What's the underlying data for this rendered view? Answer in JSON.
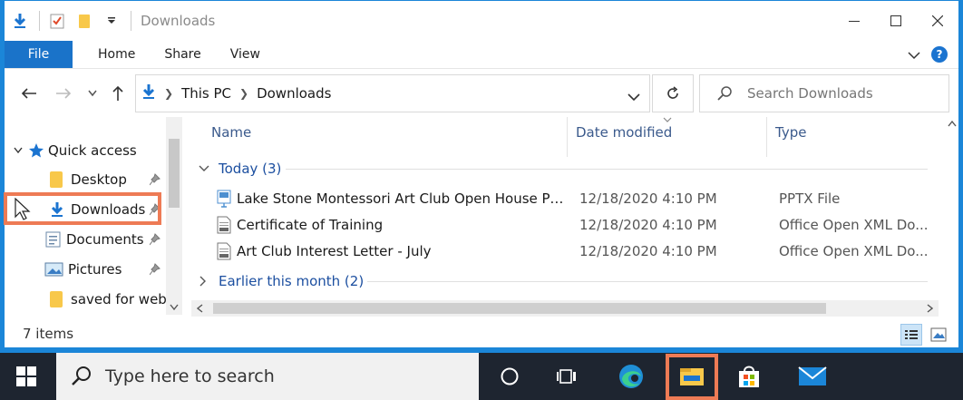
{
  "window": {
    "title": "Downloads",
    "ribbon_tabs": {
      "file": "File",
      "home": "Home",
      "share": "Share",
      "view": "View"
    },
    "help_label": "?"
  },
  "address": {
    "crumbs": [
      "This PC",
      "Downloads"
    ],
    "search_placeholder": "Search Downloads"
  },
  "nav": {
    "quick_access": "Quick access",
    "items": [
      {
        "label": "Desktop",
        "icon": "folder-icon",
        "pinned": true
      },
      {
        "label": "Downloads",
        "icon": "download-arrow-icon",
        "pinned": true,
        "selected": true
      },
      {
        "label": "Documents",
        "icon": "documents-icon",
        "pinned": true
      },
      {
        "label": "Pictures",
        "icon": "pictures-icon",
        "pinned": true
      },
      {
        "label": "saved for web_",
        "icon": "folder-icon",
        "pinned": false
      }
    ]
  },
  "columns": {
    "name": "Name",
    "date": "Date modified",
    "type": "Type"
  },
  "groups": {
    "today": "Today (3)",
    "earlier": "Earlier this month (2)"
  },
  "files": [
    {
      "name": "Lake Stone Montessori Art Club Open House Pr...",
      "date": "12/18/2020 4:10 PM",
      "type": "PPTX File",
      "icon": "pptx-file-icon"
    },
    {
      "name": "Certificate of Training",
      "date": "12/18/2020 4:10 PM",
      "type": "Office Open XML Do...",
      "icon": "docx-file-icon"
    },
    {
      "name": "Art Club Interest Letter - July",
      "date": "12/18/2020 4:10 PM",
      "type": "Office Open XML Do...",
      "icon": "docx-file-icon"
    }
  ],
  "status": {
    "count": "7 items"
  },
  "taskbar": {
    "search_text": "Type here to search"
  },
  "colors": {
    "accent": "#1b86d8",
    "highlight": "#ee7b55",
    "taskbar": "#1e2530",
    "folder": "#f8c84a"
  }
}
